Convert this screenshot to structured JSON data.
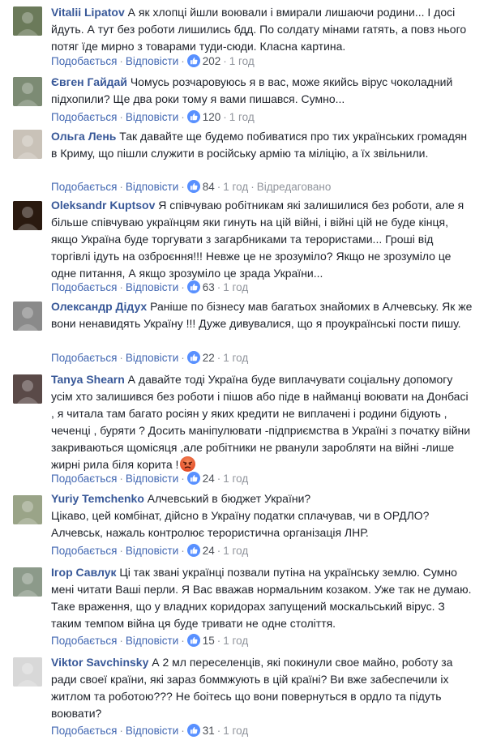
{
  "ui": {
    "like_label": "Подобається",
    "reply_label": "Відповісти",
    "separator": "·"
  },
  "comments": [
    {
      "author": "Vitalii Lipatov",
      "text": "А як хлопці йшли воювали і вмирали лишаючи родини... І досі йдуть. А тут без роботи лишились бдд. По солдату мінами гатять, а повз нього потяг їде мирно з товарами туди-сюди. Класна картина.",
      "likes": "202",
      "time": "1 год",
      "avatar_color": "#6b7a5a"
    },
    {
      "author": "Євген Гайдай",
      "text": "Чомусь розчаровуюсь я в вас, може якийсь вірус чоколадний підхопили? Ще два роки тому я вами пишався. Сумно...",
      "likes": "120",
      "time": "1 год",
      "avatar_color": "#7c8b74"
    },
    {
      "author": "Ольга Лень",
      "text": "Так давайте ще будемо побиватися про тих українських громадян в Криму, що пішли служити в російську армію та міліцію, а їх звільнили.",
      "likes": "84",
      "time": "1 год",
      "edited": "Відредаговано",
      "avatar_color": "#c9c2b8"
    },
    {
      "author": "Oleksandr Kuptsov",
      "text": "Я співчуваю робітникам які залишилися без роботи, але я більше співчуваю українцям яки гинуть на цій війні, і війні цій не буде кінця, якщо Україна буде торгувати з загарбниками та терористами... Гроші від торгівлі ідуть на озброєння!!! Невже це не зрозуміло? Якщо не зрозуміло це одне питання, А якщо зрозуміло це зрада України...",
      "likes": "63",
      "time": "1 год",
      "avatar_color": "#2a1a10"
    },
    {
      "author": "Олександр Дідух",
      "text": "Раніше по бізнесу мав багатьох знайомих в Алчевську. Як же вони ненавидять Україну !!! Дуже дивувалися, що я проукраїнські пости пишу.",
      "likes": "22",
      "time": "1 год",
      "avatar_color": "#8a8a8a"
    },
    {
      "author": "Tanya Shearn",
      "text": "А давайте тоді Україна буде виплачувати соціальну допомогу усім хто залишився без роботи і пішов або піде в найманці воювати на Донбасі , я читала там багато росіян у яких кредити не виплачені і родини бідують , чеченці , буряти ? Досить маніпулювати -підприємства в Україні з початку війни закриваються щомісяця ,але робітники не рванули заробляти на війні -лише жирні рила біля корита !",
      "likes": "24",
      "time": "1 год",
      "avatar_color": "#5a4a48"
    },
    {
      "author": "Yuriy Temchenko",
      "text": "Алчевський в бюджет України?\nЦікаво, цей комбінат, дійсно в Україну податки сплачував, чи в ОРДЛО? Алчевськ, нажаль контролює терористична організація ЛНР.",
      "likes": "24",
      "time": "1 год",
      "avatar_color": "#9aa488"
    },
    {
      "author": "Ігор Савлук",
      "text": "Ці так звані українці позвали путіна на українську землю. Сумно мені читати Ваші перли. Я Вас вважав нормальним козаком. Уже так не думаю. Таке враження, що у владних коридорах запущений москальський вірус. З таким темпом війна ця буде тривати не одне століття.",
      "likes": "15",
      "time": "1 год",
      "avatar_color": "#8c9a8a"
    },
    {
      "author": "Viktor Savchinsky",
      "text": "А 2 мл переселенців, які покинули свое майно, роботу за ради своеї країни, які зараз боммжують в цій країні? Ви вже забеспечили іх житлом та роботою??? Не боітесь що вони повернуться в ордло та підуть воювати?",
      "likes": "31",
      "time": "1 год",
      "avatar_color": "#d8d8d8"
    }
  ]
}
